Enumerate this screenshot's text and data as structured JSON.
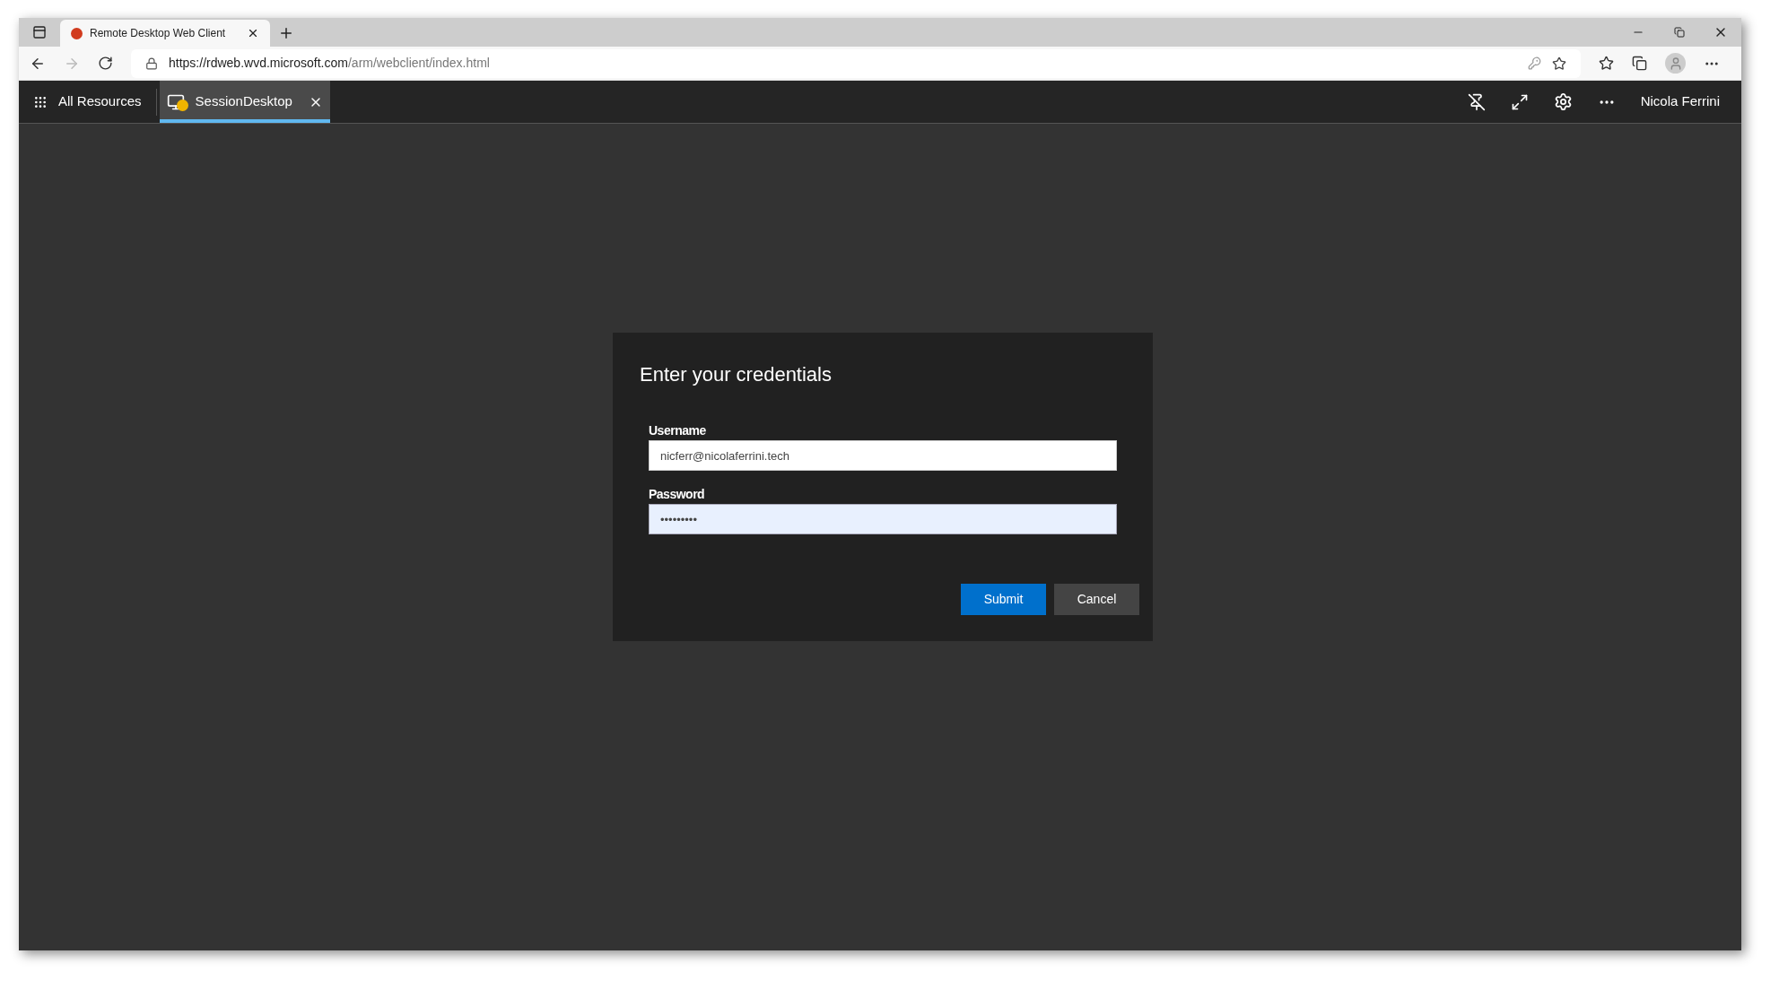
{
  "browser": {
    "tabs": [
      {
        "title": "Remote Desktop Web Client",
        "selected": true
      }
    ],
    "address": {
      "host": "https://rdweb.wvd.microsoft.com",
      "path": "/arm/webclient/index.html"
    }
  },
  "app_bar": {
    "all_resources": "All Resources",
    "session_tabs": [
      {
        "label": "SessionDesktop",
        "selected": true,
        "warning": true
      }
    ],
    "user": "Nicola Ferrini"
  },
  "dialog": {
    "title": "Enter your credentials",
    "fields": [
      {
        "label": "Username",
        "value": "nicferr@nicolaferrini.tech",
        "focused": false
      },
      {
        "label": "Password",
        "value": "•••••••••",
        "focused": true
      }
    ],
    "buttons": [
      {
        "label": "Submit",
        "primary": true
      },
      {
        "label": "Cancel",
        "primary": false
      }
    ]
  }
}
